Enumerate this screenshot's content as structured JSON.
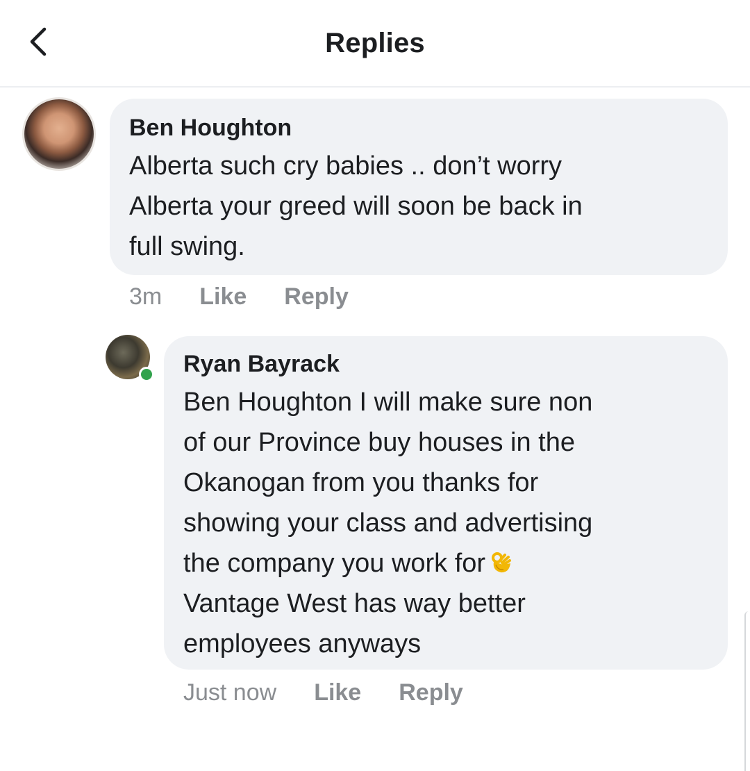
{
  "header": {
    "title": "Replies",
    "back_icon": "chevron-left-icon"
  },
  "comments": [
    {
      "author": "Ben Houghton",
      "text": "Alberta such cry babies .. don’t worry\nAlberta your greed will soon be back in\nfull swing.",
      "time": "3m",
      "like_label": "Like",
      "reply_label": "Reply"
    },
    {
      "author": "Ryan Bayrack",
      "text": "Ben Houghton I will make sure non\nof our Province buy houses in the\nOkanogan from you thanks for\nshowing your class and advertising\nthe company you work for",
      "emoji": "ok-hand-emoji",
      "text_after": "Vantage West has way better\nemployees anyways",
      "time": "Just now",
      "like_label": "Like",
      "reply_label": "Reply",
      "online": true
    }
  ],
  "colors": {
    "bubble": "#f0f2f5",
    "secondary_text": "#8a8d91",
    "online": "#31a24c"
  }
}
